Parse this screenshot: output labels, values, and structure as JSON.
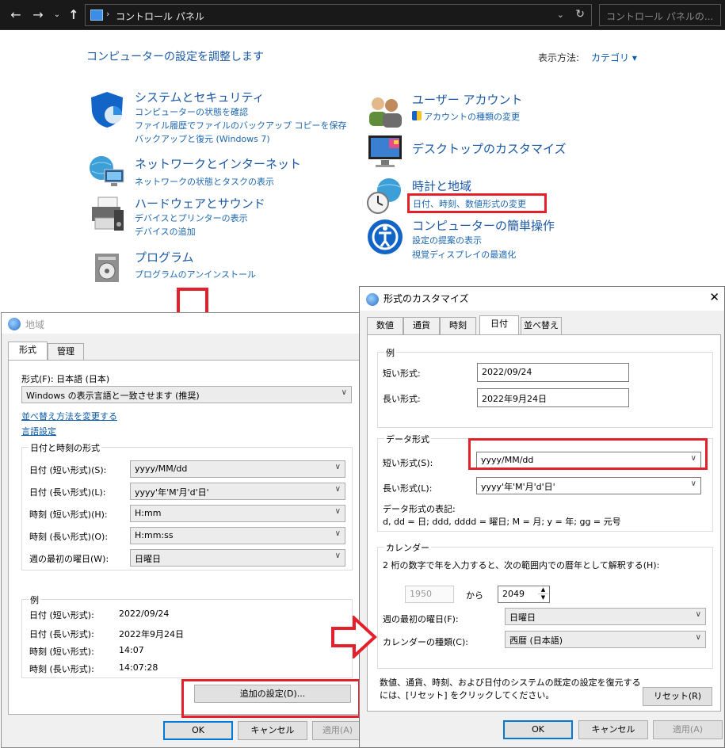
{
  "address": {
    "path": "コントロール パネル",
    "search_placeholder": "コントロール パネルの..."
  },
  "control_panel": {
    "title": "コンピューターの設定を調整します",
    "view_label": "表示方法:",
    "view_value": "カテゴリ",
    "categories": [
      {
        "title": "システムとセキュリティ",
        "links": [
          "コンピューターの状態を確認",
          "ファイル履歴でファイルのバックアップ コピーを保存",
          "バックアップと復元 (Windows 7)"
        ]
      },
      {
        "title": "ネットワークとインターネット",
        "links": [
          "ネットワークの状態とタスクの表示"
        ]
      },
      {
        "title": "ハードウェアとサウンド",
        "links": [
          "デバイスとプリンターの表示",
          "デバイスの追加"
        ]
      },
      {
        "title": "プログラム",
        "links": [
          "プログラムのアンインストール"
        ]
      },
      {
        "title": "ユーザー アカウント",
        "links": [
          "アカウントの種類の変更"
        ]
      },
      {
        "title": "デスクトップのカスタマイズ",
        "links": []
      },
      {
        "title": "時計と地域",
        "links": [
          "日付、時刻、数値形式の変更"
        ]
      },
      {
        "title": "コンピューターの簡単操作",
        "links": [
          "設定の提案の表示",
          "視覚ディスプレイの最適化"
        ]
      }
    ]
  },
  "region_dialog": {
    "title": "地域",
    "tabs": [
      "形式",
      "管理"
    ],
    "format_label": "形式(F): 日本語 (日本)",
    "format_value": "Windows の表示言語と一致させます (推奨)",
    "link_sort": "並べ替え方法を変更する",
    "link_lang": "言語設定",
    "group_datetime": "日付と時刻の形式",
    "rows": [
      {
        "label": "日付 (短い形式)(S):",
        "value": "yyyy/MM/dd"
      },
      {
        "label": "日付 (長い形式)(L):",
        "value": "yyyy'年'M'月'd'日'"
      },
      {
        "label": "時刻 (短い形式)(H):",
        "value": "H:mm"
      },
      {
        "label": "時刻 (長い形式)(O):",
        "value": "H:mm:ss"
      },
      {
        "label": "週の最初の曜日(W):",
        "value": "日曜日"
      }
    ],
    "group_example": "例",
    "examples": [
      {
        "label": "日付 (短い形式):",
        "value": "2022/09/24"
      },
      {
        "label": "日付 (長い形式):",
        "value": "2022年9月24日"
      },
      {
        "label": "時刻 (短い形式):",
        "value": "14:07"
      },
      {
        "label": "時刻 (長い形式):",
        "value": "14:07:28"
      }
    ],
    "additional": "追加の設定(D)...",
    "ok": "OK",
    "cancel": "キャンセル",
    "apply": "適用(A)"
  },
  "customize_dialog": {
    "title": "形式のカスタマイズ",
    "close": "✕",
    "tabs": [
      "数値",
      "通貨",
      "時刻",
      "日付",
      "並べ替え"
    ],
    "group_example": "例",
    "short_label": "短い形式:",
    "short_value": "2022/09/24",
    "long_label": "長い形式:",
    "long_value": "2022年9月24日",
    "group_format": "データ形式",
    "fmt_short_label": "短い形式(S):",
    "fmt_short_value": "yyyy/MM/dd",
    "fmt_long_label": "長い形式(L):",
    "fmt_long_value": "yyyy'年'M'月'd'日'",
    "notation_title": "データ形式の表記:",
    "notation": "d, dd = 日;  ddd, dddd = 曜日; M = 月; y = 年; gg = 元号",
    "group_calendar": "カレンダー",
    "two_digit": "2 桁の数字で年を入力すると、次の範囲内での暦年として解釈する(H):",
    "year_from": "1950",
    "kara": "から",
    "year_to": "2049",
    "first_day_label": "週の最初の曜日(F):",
    "first_day_value": "日曜日",
    "cal_type_label": "カレンダーの種類(C):",
    "cal_type_value": "西暦 (日本語)",
    "reset_text_1": "数値、通貨、時刻、および日付のシステムの既定の設定を復元する",
    "reset_text_2": "には、[リセット] をクリックしてください。",
    "reset": "リセット(R)",
    "ok": "OK",
    "cancel": "キャンセル",
    "apply": "適用(A)"
  }
}
